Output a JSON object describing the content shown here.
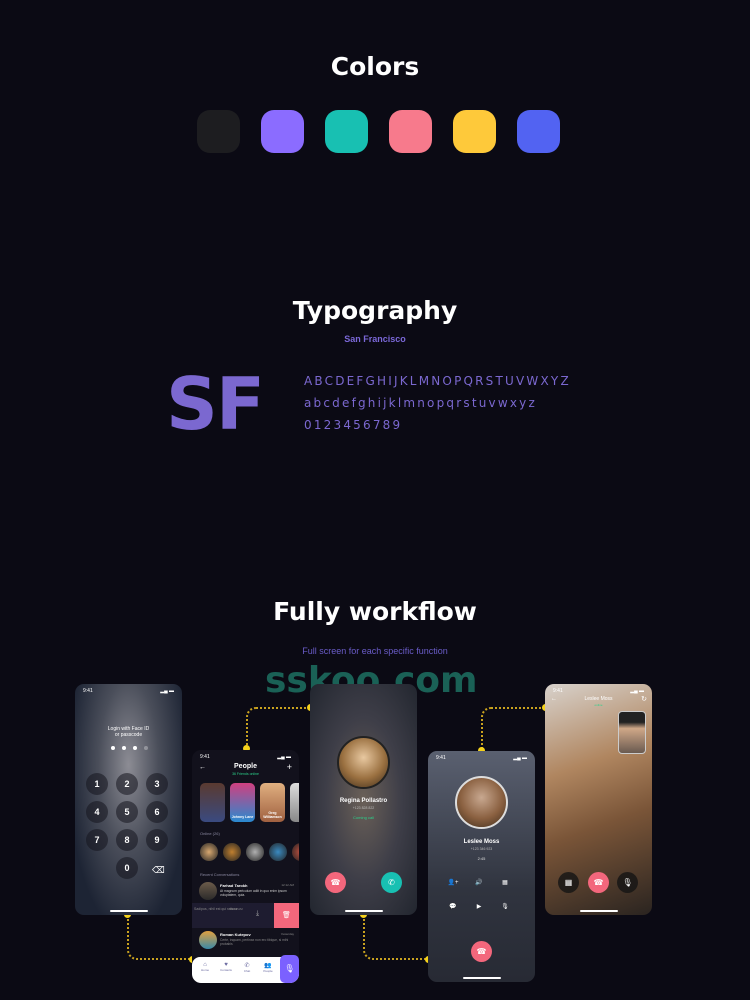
{
  "colors": {
    "title": "Colors",
    "swatches": [
      "#1d1d20",
      "#8b6cff",
      "#18c0b2",
      "#f77a8c",
      "#fec93a",
      "#5263f2"
    ]
  },
  "typography": {
    "title": "Typography",
    "font_name": "San Francisco",
    "sample": "SF",
    "uppercase": "ABCDEFGHIJKLMNOPQRSTUVWXYZ",
    "lowercase": "abcdefghijklmnopqrstuvwxyz",
    "digits": "0123456789"
  },
  "workflow": {
    "title": "Fully workflow",
    "subtitle": "Full screen for each specific function"
  },
  "watermark": "sskoo.com",
  "status_time": "9:41",
  "lock": {
    "prompt_line1": "Login with Face ID",
    "prompt_line2": "or passcode",
    "keys": [
      "1",
      "2",
      "3",
      "4",
      "5",
      "6",
      "7",
      "8",
      "9",
      "0"
    ],
    "entered_dots": 3,
    "total_dots": 4
  },
  "people": {
    "title": "People",
    "subtitle": "36 Friends online",
    "stories": [
      "",
      "Johnny Lane",
      "Greg Williamson"
    ],
    "online_label": "Online (26)",
    "recent_label": "Recent Conversations",
    "conversations": [
      {
        "name": "Farhad Tarokh",
        "message": "At magnum periculum adiit in quo enim ipsum voluptatem, quia.",
        "time": "12:12 AM"
      },
      {
        "name": "",
        "message": "Sadipus, nihil est qui ratione",
        "time": "09:12 AM"
      },
      {
        "name": "Roman Kutepov",
        "message": "Certe, inquam, pertinax non ero tibique, si mihi probabis",
        "time": "Yesterday"
      }
    ],
    "tabs": [
      "Home",
      "Contacts",
      "Chat",
      "People"
    ]
  },
  "incoming": {
    "name": "Regina Pollastro",
    "phone": "+123 828 822",
    "status": "Coming call"
  },
  "call": {
    "name": "Leslee Moss",
    "phone": "+123 346 923",
    "duration": "2:45"
  },
  "video": {
    "name": "Leslee Moss",
    "status": "online"
  },
  "accent": {
    "green": "#2bd18a",
    "red": "#f3677c",
    "teal": "#18c0b2",
    "purple": "#7b61ff",
    "yellow": "#f5d21c"
  }
}
